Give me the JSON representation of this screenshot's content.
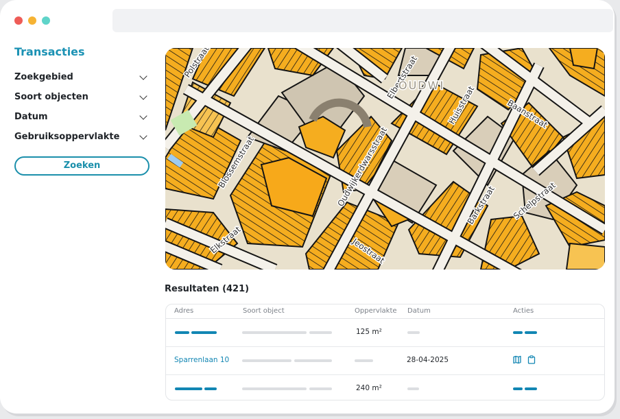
{
  "sidebar": {
    "title": "Transacties",
    "filters": [
      {
        "label": "Zoekgebied"
      },
      {
        "label": "Soort objecten"
      },
      {
        "label": "Datum"
      },
      {
        "label": "Gebruiksoppervlakte"
      }
    ],
    "search_button": "Zoeken"
  },
  "map": {
    "street_labels": [
      "Polstraat",
      "Blossemstraat",
      "Elbertstraat",
      "Huisstraat",
      "Baanstraat",
      "Oudwijkerdwarsstraat",
      "Barkstraat",
      "Schelpstraat",
      "Jeostraat",
      "Elkstraat",
      "OUDWI"
    ],
    "colors": {
      "parcel_orange": "#f5ad1f",
      "parcel_light": "#f7c352",
      "road": "#f4f1ea",
      "building_grey": "#cfc5b1",
      "outline": "#141414",
      "park": "#c8eab1",
      "water": "#9ecbee"
    }
  },
  "results": {
    "title": "Resultaten (421)",
    "columns": [
      "Adres",
      "Soort object",
      "Oppervlakte",
      "Datum",
      "Acties"
    ],
    "rows": [
      {
        "address": "",
        "area": "125 m²",
        "date": ""
      },
      {
        "address": "Sparrenlaan 10",
        "area": "",
        "date": "28-04-2025"
      },
      {
        "address": "",
        "area": "240 m²",
        "date": ""
      }
    ]
  },
  "colors": {
    "accent": "#1b92b4",
    "link": "#1286b3"
  },
  "icons": {
    "row_actions": [
      "map-icon",
      "clipboard-icon"
    ]
  }
}
